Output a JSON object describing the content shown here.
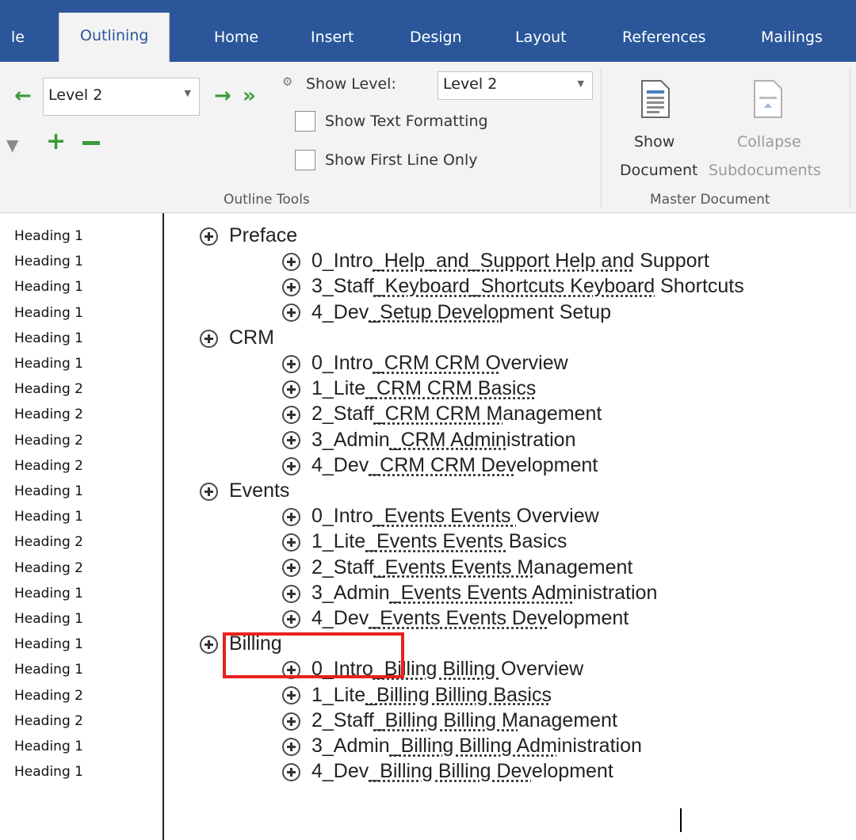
{
  "tabs": [
    {
      "label": "le"
    },
    {
      "label": "Outlining"
    },
    {
      "label": "Home"
    },
    {
      "label": "Insert"
    },
    {
      "label": "Design"
    },
    {
      "label": "Layout"
    },
    {
      "label": "References"
    },
    {
      "label": "Mailings"
    }
  ],
  "ribbon": {
    "outline_level": "Level 2",
    "show_level_label": "Show Level:",
    "show_level_value": "Level 2",
    "show_text_formatting": "Show Text Formatting",
    "show_first_line_only": "Show First Line Only",
    "outline_tools_label": "Outline Tools",
    "show_document_line1": "Show",
    "show_document_line2": "Document",
    "collapse_line1": "Collapse",
    "collapse_line2": "Subdocuments",
    "master_document_label": "Master Document"
  },
  "styles": [
    "Heading 1",
    "Heading 1",
    "Heading 1",
    "Heading 1",
    "Heading 1",
    "Heading 1",
    "Heading 2",
    "Heading 2",
    "Heading 2",
    "Heading 2",
    "Heading 1",
    "Heading 1",
    "Heading 2",
    "Heading 2",
    "Heading 1",
    "Heading 1",
    "Heading 1",
    "Heading 1",
    "Heading 2",
    "Heading 2",
    "Heading 1",
    "Heading 1"
  ],
  "outline": [
    {
      "level": 1,
      "plain": "Preface",
      "link": "",
      "tail": ""
    },
    {
      "level": 2,
      "plain": "0_Intro",
      "link": "_Help_and_Support Help and",
      "tail": " Support"
    },
    {
      "level": 2,
      "plain": "3_Staff",
      "link": "_Keyboard_Shortcuts Keyboard",
      "tail": " Shortcuts"
    },
    {
      "level": 2,
      "plain": "4_Dev",
      "link": "_Setup Develo",
      "tail": "pment Setup"
    },
    {
      "level": 1,
      "plain": "CRM",
      "link": "",
      "tail": ""
    },
    {
      "level": 2,
      "plain": "0_Intro",
      "link": "_CRM CRM O",
      "tail": "verview"
    },
    {
      "level": 2,
      "plain": "1_Lite",
      "link": "_CRM CRM Basics",
      "tail": ""
    },
    {
      "level": 2,
      "plain": "2_Staff",
      "link": "_CRM CRM M",
      "tail": "anagement"
    },
    {
      "level": 2,
      "plain": "3_Admin",
      "link": "_CRM Admin",
      "tail": "istration"
    },
    {
      "level": 2,
      "plain": "4_Dev",
      "link": "_CRM CRM Dev",
      "tail": "elopment"
    },
    {
      "level": 1,
      "plain": "Events",
      "link": "",
      "tail": ""
    },
    {
      "level": 2,
      "plain": "0_Intro",
      "link": "_Events Events ",
      "tail": "Overview"
    },
    {
      "level": 2,
      "plain": "1_Lite",
      "link": "_Events Events ",
      "tail": "Basics"
    },
    {
      "level": 2,
      "plain": "2_Staff",
      "link": "_Events Events M",
      "tail": "anagement"
    },
    {
      "level": 2,
      "plain": "3_Admin",
      "link": "_Events Events Adm",
      "tail": "inistration"
    },
    {
      "level": 2,
      "plain": "4_Dev",
      "link": "_Events Events Dev",
      "tail": "elopment"
    },
    {
      "level": 1,
      "plain": "Billing",
      "link": "",
      "tail": ""
    },
    {
      "level": 2,
      "plain": "0_Intro",
      "link": "_Billing Billing ",
      "tail": "Overview"
    },
    {
      "level": 2,
      "plain": "1_Lite",
      "link": "_Billing Billing Basics",
      "tail": ""
    },
    {
      "level": 2,
      "plain": "2_Staff",
      "link": "_Billing Billing M",
      "tail": "anagement"
    },
    {
      "level": 2,
      "plain": "3_Admin",
      "link": "_Billing Billing Adm",
      "tail": "inistration"
    },
    {
      "level": 2,
      "plain": "4_Dev",
      "link": "_Billing Billing Dev",
      "tail": "elopment"
    }
  ],
  "colors": {
    "tab_bar": "#2b579a",
    "ribbon_bg": "#f3f3f3",
    "highlight_box": "#e8221e",
    "arrow_green": "#3a9a3a"
  }
}
